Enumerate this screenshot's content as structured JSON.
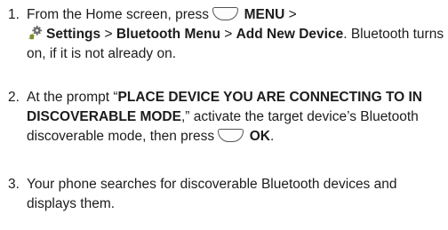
{
  "steps": [
    {
      "number": "1.",
      "t1": "From the Home screen, press",
      "t2": "MENU",
      "t3": " > ",
      "t4": "Settings",
      "t5": " > ",
      "t6": "Bluetooth Menu",
      "t7": " > ",
      "t8": "Add New Device",
      "t9": ". Bluetooth turns on, if it is not already on."
    },
    {
      "number": "2.",
      "t1": "At the prompt “",
      "t2": "PLACE DEVICE YOU ARE CONNECTING TO IN DISCOVERABLE MODE",
      "t3": ",” activate the target device’s Bluetooth discoverable mode, then press",
      "t4": "OK",
      "t5": "."
    },
    {
      "number": "3.",
      "t1": "Your phone searches for discoverable Bluetooth devices and displays them."
    }
  ],
  "icons": {
    "softkey": "left-softkey-icon",
    "settings": "settings-gear-icon"
  }
}
